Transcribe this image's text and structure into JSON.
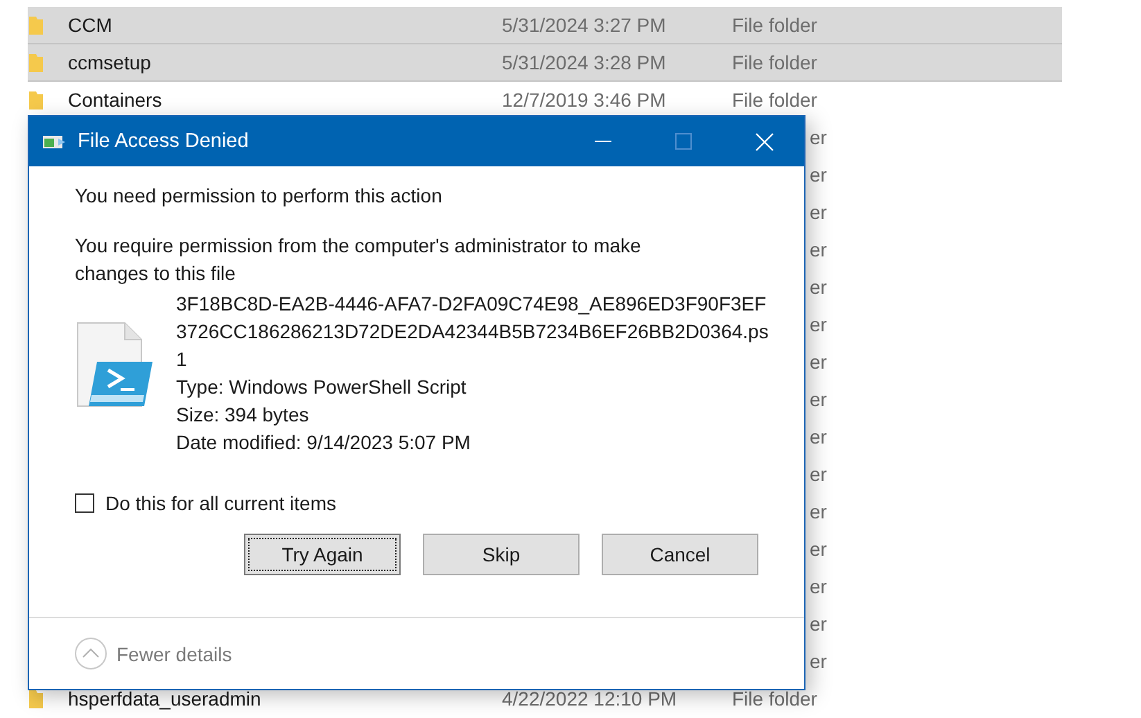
{
  "explorer_rows": [
    {
      "name": "CCM",
      "date": "5/31/2024 3:27 PM",
      "type": "File folder",
      "selected": true
    },
    {
      "name": "ccmsetup",
      "date": "5/31/2024 3:28 PM",
      "type": "File folder",
      "selected": true
    },
    {
      "name": "Containers",
      "date": "12/7/2019 3:46 PM",
      "type": "File folder",
      "selected": false
    },
    {
      "type": "er",
      "selected": false
    },
    {
      "type": "er",
      "selected": false
    },
    {
      "type": "er",
      "selected": false
    },
    {
      "type": "er",
      "selected": false
    },
    {
      "type": "er",
      "selected": false
    },
    {
      "type": "er",
      "selected": false
    },
    {
      "type": "er",
      "selected": false
    },
    {
      "type": "er",
      "selected": false
    },
    {
      "type": "er",
      "selected": false
    },
    {
      "type": "er",
      "selected": false
    },
    {
      "type": "er",
      "selected": false
    },
    {
      "type": "er",
      "selected": false
    },
    {
      "type": "er",
      "selected": false
    },
    {
      "type": "er",
      "selected": false
    },
    {
      "type": "er",
      "selected": false
    },
    {
      "name": "hsperfdata_useradmin",
      "date": "4/22/2022 12:10 PM",
      "type": "File folder",
      "selected": false
    }
  ],
  "dialog": {
    "title": "File Access Denied",
    "window_controls": [
      {
        "kind": "minimize",
        "disabled": false
      },
      {
        "kind": "maximize",
        "disabled": true
      },
      {
        "kind": "close",
        "disabled": false
      }
    ],
    "heading": "You need permission to perform this action",
    "message": "You require permission from the computer's administrator to make changes to this file",
    "file": {
      "name": "3F18BC8D-EA2B-4446-AFA7-D2FA09C74E98_AE896ED3F90F3EF3726CC186286213D72DE2DA42344B5B7234B6EF26BB2D0364.ps1",
      "type": "Type: Windows PowerShell Script",
      "size": "Size: 394 bytes",
      "modified": "Date modified: 9/14/2023 5:07 PM"
    },
    "checkbox": {
      "label": "Do this for all current items",
      "checked": false
    },
    "buttons": [
      {
        "label": "Try Again",
        "focused": true
      },
      {
        "label": "Skip",
        "focused": false
      },
      {
        "label": "Cancel",
        "focused": false
      }
    ],
    "details_toggle": {
      "label": "Fewer details",
      "expanded": true
    }
  }
}
